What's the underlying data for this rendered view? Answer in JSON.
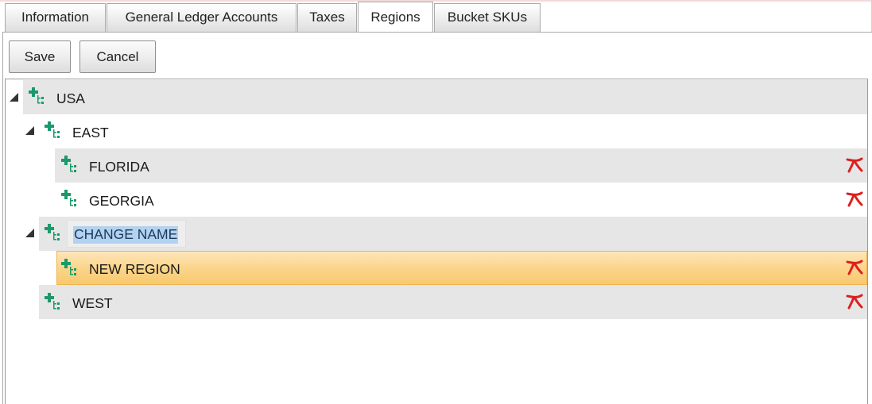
{
  "tabs": [
    "Information",
    "General Ledger Accounts",
    "Taxes",
    "Regions",
    "Bucket SKUs"
  ],
  "active_tab": "Regions",
  "toolbar": {
    "save_label": "Save",
    "cancel_label": "Cancel"
  },
  "tree": {
    "nodes": [
      {
        "label": "USA",
        "expanded": true,
        "deletable": false
      },
      {
        "label": "EAST",
        "expanded": true,
        "deletable": false
      },
      {
        "label": "FLORIDA",
        "deletable": true
      },
      {
        "label": "GEORGIA",
        "deletable": true
      },
      {
        "label": "CHANGE NAME",
        "expanded": true,
        "editing": true,
        "deletable": false
      },
      {
        "label": "NEW REGION",
        "selected": true,
        "deletable": true
      },
      {
        "label": "WEST",
        "deletable": true
      }
    ]
  },
  "icons": {
    "add": "add-child-node-icon",
    "delete": "delete-node-icon",
    "expand": "expanded-triangle-icon"
  },
  "colors": {
    "add_icon": "#1a9a6a",
    "delete_icon": "#dd1f1f",
    "selection": "#fbd58c",
    "text_selection": "#b3d2ef"
  }
}
